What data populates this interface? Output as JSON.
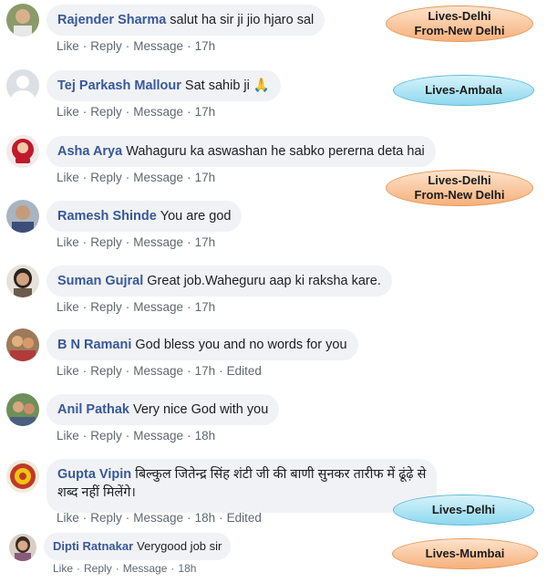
{
  "actions": {
    "like": "Like",
    "reply": "Reply",
    "message": "Message",
    "sep": "·"
  },
  "comments": [
    {
      "author": "Rajender Sharma",
      "text": "salut ha sir ji jio hjaro sal",
      "time": "17h",
      "edited": ""
    },
    {
      "author": "Tej Parkash Mallour",
      "text": "Sat sahib ji 🙏",
      "time": "17h",
      "edited": ""
    },
    {
      "author": "Asha Arya",
      "text": "Wahaguru ka aswashan he sabko pererna deta hai",
      "time": "17h",
      "edited": ""
    },
    {
      "author": "Ramesh Shinde",
      "text": "You are god",
      "time": "17h",
      "edited": ""
    },
    {
      "author": "Suman Gujral",
      "text": "Great job.Waheguru aap ki raksha kare.",
      "time": "17h",
      "edited": ""
    },
    {
      "author": "B N Ramani",
      "text": "God bless you and no words for you",
      "time": "17h",
      "edited": "Edited"
    },
    {
      "author": "Anil Pathak",
      "text": "Very nice God with you",
      "time": "18h",
      "edited": ""
    },
    {
      "author": "Gupta Vipin",
      "text": "बिल्कुल जितेन्द्र सिंह शंटी जी की बाणी सुनकर तारीफ में ढूंढ़े से",
      "text2": "शब्द नहीं मिलेंगे।",
      "time": "18h",
      "edited": "Edited"
    },
    {
      "author": "Dipti Ratnakar",
      "text": "Verygood job sir",
      "time": "18h",
      "edited": ""
    }
  ],
  "tags": [
    {
      "line1": "Lives-Delhi",
      "line2": "From-New Delhi",
      "color": "orange"
    },
    {
      "line1": "Lives-Ambala",
      "line2": "",
      "color": "blue"
    },
    {
      "line1": "Lives-Delhi",
      "line2": "From-New Delhi",
      "color": "orange"
    },
    {
      "line1": "Lives-Delhi",
      "line2": "",
      "color": "blue"
    },
    {
      "line1": "Lives-Mumbai",
      "line2": "",
      "color": "orange"
    }
  ],
  "colors": {
    "name": "#385898",
    "bubble": "#f0f2f5",
    "meta": "#606770"
  }
}
